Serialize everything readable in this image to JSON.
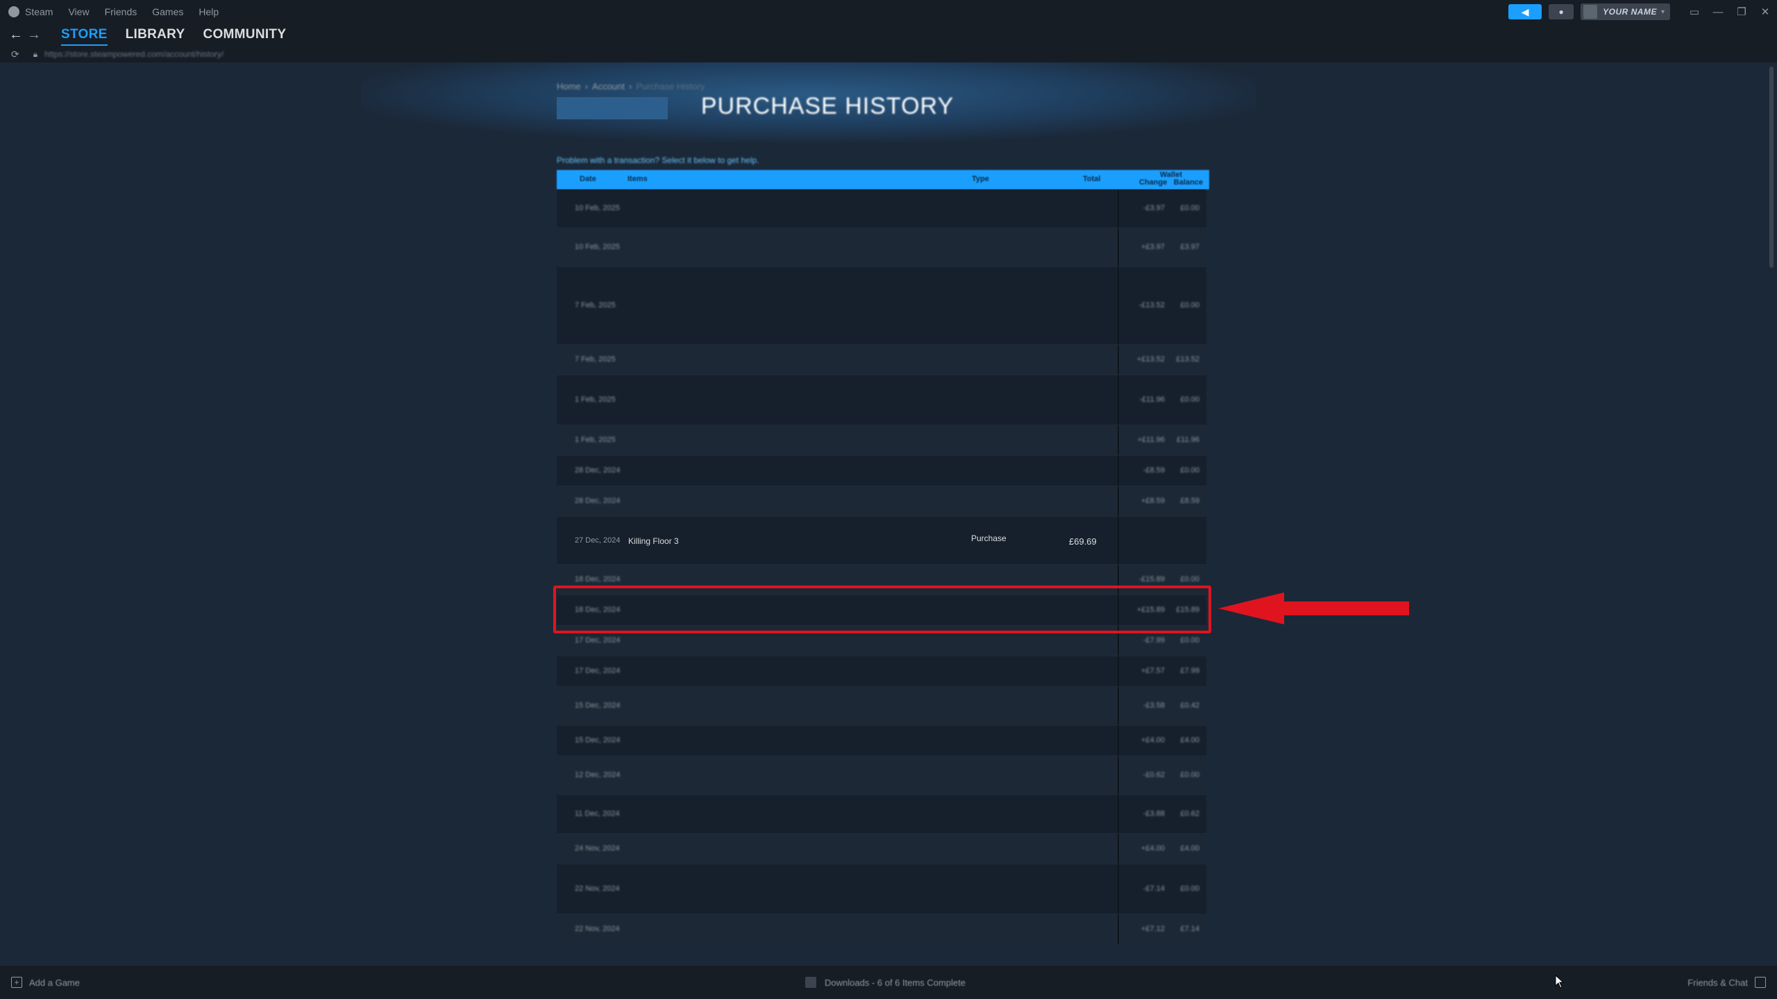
{
  "titlebar": {
    "menu": [
      "Steam",
      "View",
      "Friends",
      "Games",
      "Help"
    ],
    "user_name": "YOUR NAME"
  },
  "nav": {
    "tabs": [
      "STORE",
      "LIBRARY",
      "COMMUNITY"
    ],
    "active_tab": "STORE",
    "url": "https://store.steampowered.com/account/history/"
  },
  "page": {
    "breadcrumb": [
      "Home",
      "Account",
      "Purchase History"
    ],
    "title": "PURCHASE HISTORY",
    "help_text": "Problem with a transaction? Select it below to get help."
  },
  "table": {
    "headers": {
      "date": "Date",
      "items": "Items",
      "type": "Type",
      "total": "Total",
      "wallet": "Wallet",
      "wallet_change": "Change",
      "wallet_balance": "Balance"
    },
    "rows": [
      {
        "date": "10 Feb, 2025",
        "items": "",
        "type": "",
        "total": "",
        "wallet_change": "-£3.97",
        "wallet_balance": "£0.00"
      },
      {
        "date": "10 Feb, 2025",
        "items": "",
        "type": "",
        "total": "",
        "wallet_change": "+£3.97",
        "wallet_balance": "£3.97"
      },
      {
        "date": "7 Feb, 2025",
        "items": "",
        "type": "",
        "total": "",
        "wallet_change": "-£13.52",
        "wallet_balance": "£0.00"
      },
      {
        "date": "7 Feb, 2025",
        "items": "",
        "type": "",
        "total": "",
        "wallet_change": "+£13.52",
        "wallet_balance": "£13.52"
      },
      {
        "date": "1 Feb, 2025",
        "items": "",
        "type": "",
        "total": "",
        "wallet_change": "-£11.96",
        "wallet_balance": "£0.00"
      },
      {
        "date": "1 Feb, 2025",
        "items": "",
        "type": "",
        "total": "",
        "wallet_change": "+£11.96",
        "wallet_balance": "£11.96"
      },
      {
        "date": "28 Dec, 2024",
        "items": "",
        "type": "",
        "total": "",
        "wallet_change": "-£8.59",
        "wallet_balance": "£0.00"
      },
      {
        "date": "28 Dec, 2024",
        "items": "",
        "type": "",
        "total": "",
        "wallet_change": "+£8.59",
        "wallet_balance": "£8.59"
      },
      {
        "date": "27 Dec, 2024",
        "items": "Killing Floor 3",
        "type": "Purchase",
        "total": "£69.69",
        "wallet_change": "",
        "wallet_balance": ""
      },
      {
        "date": "18 Dec, 2024",
        "items": "",
        "type": "",
        "total": "",
        "wallet_change": "-£15.89",
        "wallet_balance": "£0.00"
      },
      {
        "date": "18 Dec, 2024",
        "items": "",
        "type": "",
        "total": "",
        "wallet_change": "+£15.89",
        "wallet_balance": "£15.89"
      },
      {
        "date": "17 Dec, 2024",
        "items": "",
        "type": "",
        "total": "",
        "wallet_change": "-£7.99",
        "wallet_balance": "£0.00"
      },
      {
        "date": "17 Dec, 2024",
        "items": "",
        "type": "",
        "total": "",
        "wallet_change": "+£7.57",
        "wallet_balance": "£7.99"
      },
      {
        "date": "15 Dec, 2024",
        "items": "",
        "type": "",
        "total": "",
        "wallet_change": "-£3.58",
        "wallet_balance": "£0.42"
      },
      {
        "date": "15 Dec, 2024",
        "items": "",
        "type": "",
        "total": "",
        "wallet_change": "+£4.00",
        "wallet_balance": "£4.00"
      },
      {
        "date": "12 Dec, 2024",
        "items": "",
        "type": "",
        "total": "",
        "wallet_change": "-£0.62",
        "wallet_balance": "£0.00"
      },
      {
        "date": "11 Dec, 2024",
        "items": "",
        "type": "",
        "total": "",
        "wallet_change": "-£3.88",
        "wallet_balance": "£0.62"
      },
      {
        "date": "24 Nov, 2024",
        "items": "",
        "type": "",
        "total": "",
        "wallet_change": "+£4.00",
        "wallet_balance": "£4.00"
      },
      {
        "date": "22 Nov, 2024",
        "items": "",
        "type": "",
        "total": "",
        "wallet_change": "-£7.14",
        "wallet_balance": "£0.00"
      },
      {
        "date": "22 Nov, 2024",
        "items": "",
        "type": "",
        "total": "",
        "wallet_change": "+£7.12",
        "wallet_balance": "£7.14"
      }
    ]
  },
  "footer": {
    "add_game": "Add a Game",
    "downloads": "Downloads - 6 of 6 Items Complete",
    "friends": "Friends & Chat"
  },
  "colors": {
    "accent": "#1a9fff",
    "highlight": "#e0141e",
    "background": "#1b2838"
  }
}
